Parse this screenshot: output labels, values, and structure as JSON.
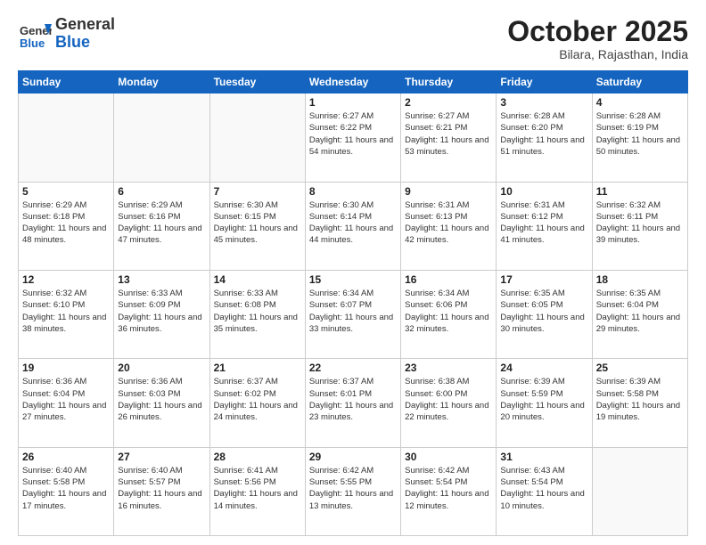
{
  "header": {
    "logo_general": "General",
    "logo_blue": "Blue",
    "month_title": "October 2025",
    "location": "Bilara, Rajasthan, India"
  },
  "weekdays": [
    "Sunday",
    "Monday",
    "Tuesday",
    "Wednesday",
    "Thursday",
    "Friday",
    "Saturday"
  ],
  "weeks": [
    [
      {
        "day": "",
        "sunrise": "",
        "sunset": "",
        "daylight": ""
      },
      {
        "day": "",
        "sunrise": "",
        "sunset": "",
        "daylight": ""
      },
      {
        "day": "",
        "sunrise": "",
        "sunset": "",
        "daylight": ""
      },
      {
        "day": "1",
        "sunrise": "Sunrise: 6:27 AM",
        "sunset": "Sunset: 6:22 PM",
        "daylight": "Daylight: 11 hours and 54 minutes."
      },
      {
        "day": "2",
        "sunrise": "Sunrise: 6:27 AM",
        "sunset": "Sunset: 6:21 PM",
        "daylight": "Daylight: 11 hours and 53 minutes."
      },
      {
        "day": "3",
        "sunrise": "Sunrise: 6:28 AM",
        "sunset": "Sunset: 6:20 PM",
        "daylight": "Daylight: 11 hours and 51 minutes."
      },
      {
        "day": "4",
        "sunrise": "Sunrise: 6:28 AM",
        "sunset": "Sunset: 6:19 PM",
        "daylight": "Daylight: 11 hours and 50 minutes."
      }
    ],
    [
      {
        "day": "5",
        "sunrise": "Sunrise: 6:29 AM",
        "sunset": "Sunset: 6:18 PM",
        "daylight": "Daylight: 11 hours and 48 minutes."
      },
      {
        "day": "6",
        "sunrise": "Sunrise: 6:29 AM",
        "sunset": "Sunset: 6:16 PM",
        "daylight": "Daylight: 11 hours and 47 minutes."
      },
      {
        "day": "7",
        "sunrise": "Sunrise: 6:30 AM",
        "sunset": "Sunset: 6:15 PM",
        "daylight": "Daylight: 11 hours and 45 minutes."
      },
      {
        "day": "8",
        "sunrise": "Sunrise: 6:30 AM",
        "sunset": "Sunset: 6:14 PM",
        "daylight": "Daylight: 11 hours and 44 minutes."
      },
      {
        "day": "9",
        "sunrise": "Sunrise: 6:31 AM",
        "sunset": "Sunset: 6:13 PM",
        "daylight": "Daylight: 11 hours and 42 minutes."
      },
      {
        "day": "10",
        "sunrise": "Sunrise: 6:31 AM",
        "sunset": "Sunset: 6:12 PM",
        "daylight": "Daylight: 11 hours and 41 minutes."
      },
      {
        "day": "11",
        "sunrise": "Sunrise: 6:32 AM",
        "sunset": "Sunset: 6:11 PM",
        "daylight": "Daylight: 11 hours and 39 minutes."
      }
    ],
    [
      {
        "day": "12",
        "sunrise": "Sunrise: 6:32 AM",
        "sunset": "Sunset: 6:10 PM",
        "daylight": "Daylight: 11 hours and 38 minutes."
      },
      {
        "day": "13",
        "sunrise": "Sunrise: 6:33 AM",
        "sunset": "Sunset: 6:09 PM",
        "daylight": "Daylight: 11 hours and 36 minutes."
      },
      {
        "day": "14",
        "sunrise": "Sunrise: 6:33 AM",
        "sunset": "Sunset: 6:08 PM",
        "daylight": "Daylight: 11 hours and 35 minutes."
      },
      {
        "day": "15",
        "sunrise": "Sunrise: 6:34 AM",
        "sunset": "Sunset: 6:07 PM",
        "daylight": "Daylight: 11 hours and 33 minutes."
      },
      {
        "day": "16",
        "sunrise": "Sunrise: 6:34 AM",
        "sunset": "Sunset: 6:06 PM",
        "daylight": "Daylight: 11 hours and 32 minutes."
      },
      {
        "day": "17",
        "sunrise": "Sunrise: 6:35 AM",
        "sunset": "Sunset: 6:05 PM",
        "daylight": "Daylight: 11 hours and 30 minutes."
      },
      {
        "day": "18",
        "sunrise": "Sunrise: 6:35 AM",
        "sunset": "Sunset: 6:04 PM",
        "daylight": "Daylight: 11 hours and 29 minutes."
      }
    ],
    [
      {
        "day": "19",
        "sunrise": "Sunrise: 6:36 AM",
        "sunset": "Sunset: 6:04 PM",
        "daylight": "Daylight: 11 hours and 27 minutes."
      },
      {
        "day": "20",
        "sunrise": "Sunrise: 6:36 AM",
        "sunset": "Sunset: 6:03 PM",
        "daylight": "Daylight: 11 hours and 26 minutes."
      },
      {
        "day": "21",
        "sunrise": "Sunrise: 6:37 AM",
        "sunset": "Sunset: 6:02 PM",
        "daylight": "Daylight: 11 hours and 24 minutes."
      },
      {
        "day": "22",
        "sunrise": "Sunrise: 6:37 AM",
        "sunset": "Sunset: 6:01 PM",
        "daylight": "Daylight: 11 hours and 23 minutes."
      },
      {
        "day": "23",
        "sunrise": "Sunrise: 6:38 AM",
        "sunset": "Sunset: 6:00 PM",
        "daylight": "Daylight: 11 hours and 22 minutes."
      },
      {
        "day": "24",
        "sunrise": "Sunrise: 6:39 AM",
        "sunset": "Sunset: 5:59 PM",
        "daylight": "Daylight: 11 hours and 20 minutes."
      },
      {
        "day": "25",
        "sunrise": "Sunrise: 6:39 AM",
        "sunset": "Sunset: 5:58 PM",
        "daylight": "Daylight: 11 hours and 19 minutes."
      }
    ],
    [
      {
        "day": "26",
        "sunrise": "Sunrise: 6:40 AM",
        "sunset": "Sunset: 5:58 PM",
        "daylight": "Daylight: 11 hours and 17 minutes."
      },
      {
        "day": "27",
        "sunrise": "Sunrise: 6:40 AM",
        "sunset": "Sunset: 5:57 PM",
        "daylight": "Daylight: 11 hours and 16 minutes."
      },
      {
        "day": "28",
        "sunrise": "Sunrise: 6:41 AM",
        "sunset": "Sunset: 5:56 PM",
        "daylight": "Daylight: 11 hours and 14 minutes."
      },
      {
        "day": "29",
        "sunrise": "Sunrise: 6:42 AM",
        "sunset": "Sunset: 5:55 PM",
        "daylight": "Daylight: 11 hours and 13 minutes."
      },
      {
        "day": "30",
        "sunrise": "Sunrise: 6:42 AM",
        "sunset": "Sunset: 5:54 PM",
        "daylight": "Daylight: 11 hours and 12 minutes."
      },
      {
        "day": "31",
        "sunrise": "Sunrise: 6:43 AM",
        "sunset": "Sunset: 5:54 PM",
        "daylight": "Daylight: 11 hours and 10 minutes."
      },
      {
        "day": "",
        "sunrise": "",
        "sunset": "",
        "daylight": ""
      }
    ]
  ]
}
